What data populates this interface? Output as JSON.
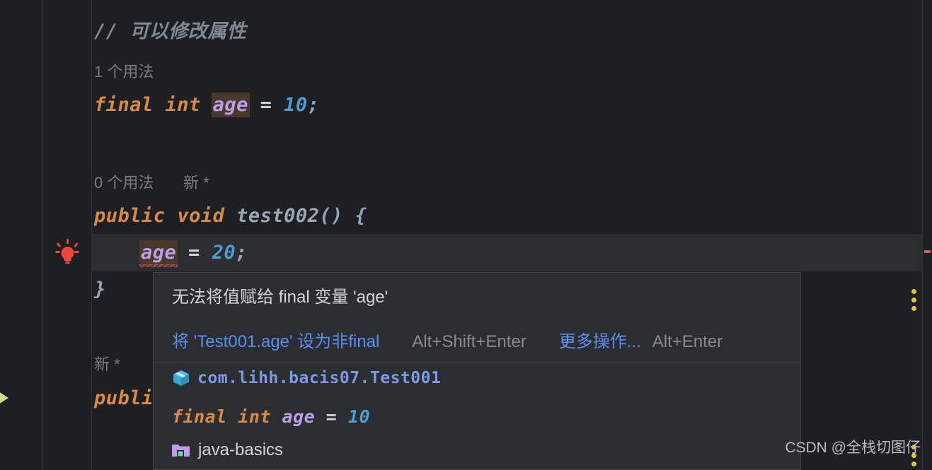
{
  "editor": {
    "lines": [
      {
        "id": "comment",
        "text": "// 可以修改属性"
      },
      {
        "id": "usage1",
        "text": "1 个用法"
      },
      {
        "id": "field",
        "kw1": "final",
        "kw2": "int",
        "ident": "age",
        "op": "=",
        "num": "10",
        "semi": ";"
      },
      {
        "id": "usage0",
        "text": "0 个用法",
        "hint": "新 *"
      },
      {
        "id": "method",
        "kw1": "public",
        "kw2": "void",
        "name": "test002",
        "parens": "()",
        "brace": "{"
      },
      {
        "id": "assign",
        "ident": "age",
        "op": "=",
        "num": "20",
        "semi": ";"
      },
      {
        "id": "close",
        "text": "}"
      },
      {
        "id": "usage2",
        "hint": "新 *"
      },
      {
        "id": "method2",
        "text": "publi"
      }
    ]
  },
  "gutter": {
    "bulb_icon": "lightbulb-icon",
    "run_icon": "run-arrow-icon"
  },
  "popup": {
    "title": "无法将值赋给 final 变量 'age'",
    "action_primary": "将 'Test001.age' 设为非final",
    "action_primary_shortcut": "Alt+Shift+Enter",
    "action_more": "更多操作...",
    "action_more_shortcut": "Alt+Enter",
    "menu_icon": "kebab-menu-icon",
    "doc": {
      "package_icon": "package-icon",
      "package_path": "com.lihh.bacis07.Test001",
      "signature": {
        "kw1": "final",
        "kw2": "int",
        "ident": "age",
        "op": "=",
        "num": "10"
      },
      "module_icon": "module-folder-icon",
      "module_name": "java-basics"
    }
  },
  "watermark": {
    "text": "CSDN @全栈切图仔"
  },
  "colors": {
    "background": "#1e1f22",
    "popup_bg": "#2b2d30",
    "keyword": "#d98b46",
    "identifier": "#b9a1e8",
    "number": "#4e9fd1",
    "link": "#5b8ef0",
    "error": "#c94f4f",
    "bulb": "#f0453a",
    "run": "#c5e08a",
    "accent_yellow": "#e8c23a"
  }
}
